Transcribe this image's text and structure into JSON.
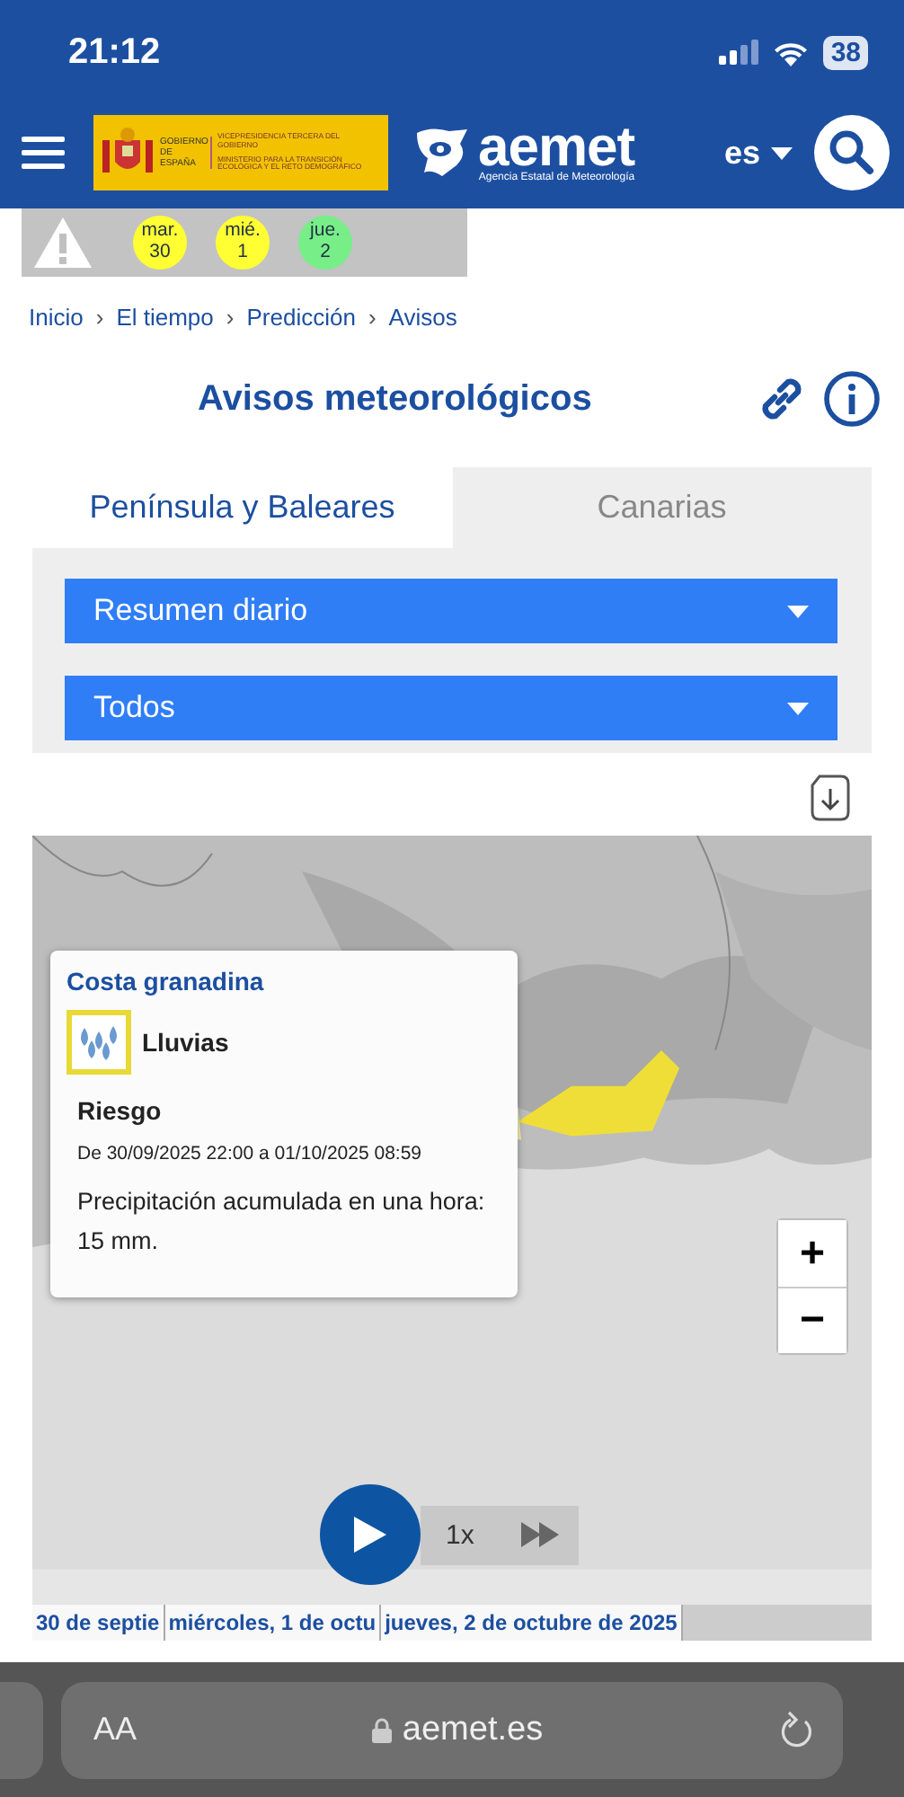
{
  "status_bar": {
    "time": "21:12",
    "battery": "38"
  },
  "header": {
    "gov_logo": {
      "left": "GOBIERNO DE ESPAÑA",
      "right_top": "VICEPRESIDENCIA TERCERA DEL GOBIERNO",
      "right_bottom": "MINISTERIO PARA LA TRANSICIÓN ECOLÓGICA Y EL RETO DEMOGRÁFICO"
    },
    "brand": "aemet",
    "brand_subtitle": "Agencia Estatal de Meteorología",
    "language": "es"
  },
  "warning_days": [
    {
      "weekday": "mar.",
      "day": "30",
      "color": "#ffff33"
    },
    {
      "weekday": "mié.",
      "day": "1",
      "color": "#ffff33"
    },
    {
      "weekday": "jue.",
      "day": "2",
      "color": "#77ee88"
    }
  ],
  "breadcrumb": {
    "separator": "›",
    "items": [
      "Inicio",
      "El tiempo",
      "Predicción",
      "Avisos"
    ]
  },
  "title": "Avisos meteorológicos",
  "tabs": [
    {
      "label": "Península y Baleares",
      "selected": true
    },
    {
      "label": "Canarias",
      "selected": false
    }
  ],
  "dropdowns": [
    "Resumen diario",
    "Todos"
  ],
  "map": {
    "popup": {
      "zone": "Costa granadina",
      "phenomenon": "Lluvias",
      "risk_label": "Riesgo",
      "period": "De 30/09/2025 22:00 a 01/10/2025 08:59",
      "description": "Precipitación acumulada en una hora: 15 mm."
    },
    "zoom_buttons": [
      "+",
      "−"
    ],
    "speed": "1x"
  },
  "timeline": [
    "30 de septie",
    "miércoles, 1 de octu",
    "jueves, 2 de octubre de 2025"
  ],
  "browser": {
    "text_size": "AA",
    "url": "aemet.es"
  }
}
